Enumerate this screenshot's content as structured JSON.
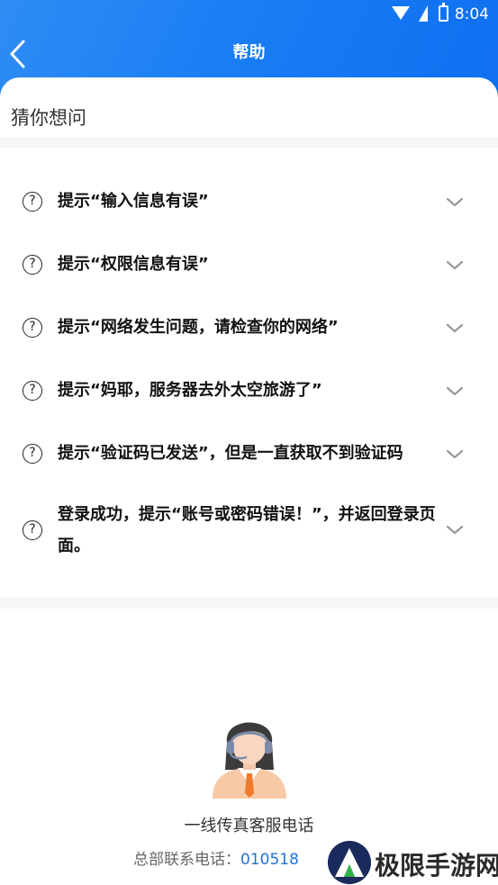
{
  "status_bar": {
    "time": "8:04"
  },
  "header": {
    "title": "帮助"
  },
  "section": {
    "heading": "猜你想问"
  },
  "faq": [
    {
      "text": "提示“输入信息有误”"
    },
    {
      "text": "提示“权限信息有误”"
    },
    {
      "text": "提示“网络发生问题，请检查你的网络”"
    },
    {
      "text": "提示“妈耶，服务器去外太空旅游了”"
    },
    {
      "text": "提示“验证码已发送”，但是一直获取不到验证码"
    },
    {
      "text": "登录成功，提示“账号或密码错误！”，并返回登录页面。"
    }
  ],
  "contact": {
    "line_label": "一线传真客服电话",
    "hq_label": "总部联系电话：",
    "hq_number": "010518"
  },
  "watermark": {
    "text": "极限手游网"
  },
  "colors": {
    "accent": "#1a7ef5",
    "link": "#2272d6"
  }
}
